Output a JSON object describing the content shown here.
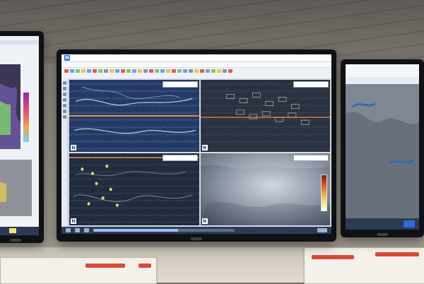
{
  "scene": {
    "description_label": "",
    "monitors": [
      {
        "role": "left-monitor"
      },
      {
        "role": "center-monitor"
      },
      {
        "role": "right-monitor"
      }
    ]
  },
  "center_app": {
    "title_text": "",
    "menu": [
      "",
      "",
      "",
      "",
      "",
      ""
    ],
    "status_progress_percent": 60
  },
  "colors": {
    "map_bg": "#1c2430",
    "relief_blue": "#233a66",
    "contour": "#9fb4d8",
    "border_white": "#ffffff",
    "accent_orange": "#ff9a3c",
    "yellow_green": "#cde94a",
    "warning_red": "#d94b35"
  },
  "icons": [
    "logo-n-icon",
    "map-north-icon",
    "toolbar-icon",
    "status-button-icon"
  ]
}
